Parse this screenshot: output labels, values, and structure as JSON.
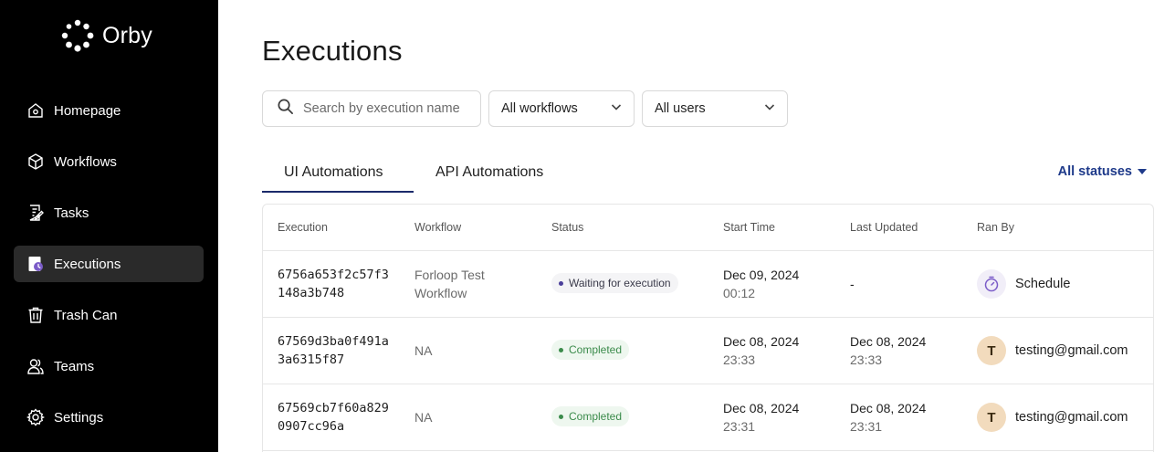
{
  "app": {
    "logo_text": "Orby"
  },
  "sidebar": {
    "items": [
      {
        "label": "Homepage",
        "icon": "home-icon"
      },
      {
        "label": "Workflows",
        "icon": "cube-icon"
      },
      {
        "label": "Tasks",
        "icon": "tasks-icon"
      },
      {
        "label": "Executions",
        "icon": "executions-icon",
        "active": true
      },
      {
        "label": "Trash Can",
        "icon": "trash-icon"
      },
      {
        "label": "Teams",
        "icon": "teams-icon"
      },
      {
        "label": "Settings",
        "icon": "gear-icon"
      }
    ]
  },
  "main": {
    "title": "Executions",
    "search_placeholder": "Search by execution name",
    "workflow_filter": "All workflows",
    "user_filter": "All users",
    "tabs": [
      {
        "label": "UI Automations",
        "active": true
      },
      {
        "label": "API Automations",
        "active": false
      }
    ],
    "status_filter": "All statuses"
  },
  "table": {
    "columns": [
      "Execution",
      "Workflow",
      "Status",
      "Start Time",
      "Last Updated",
      "Ran By"
    ],
    "rows": [
      {
        "execution": "6756a653f2c57f3148a3b748",
        "workflow": "Forloop Test Workflow",
        "status": "Waiting for execution",
        "start_date": "Dec 09, 2024",
        "start_time": "00:12",
        "updated": "-",
        "ran_by": "Schedule"
      },
      {
        "execution": "67569d3ba0f491a3a6315f87",
        "workflow": "NA",
        "status": "Completed",
        "start_date": "Dec 08, 2024",
        "start_time": "23:33",
        "updated_date": "Dec 08, 2024",
        "updated_time": "23:33",
        "avatar": "T",
        "ran_by": "testing@gmail.com"
      },
      {
        "execution": "67569cb7f60a8290907cc96a",
        "workflow": "NA",
        "status": "Completed",
        "start_date": "Dec 08, 2024",
        "start_time": "23:31",
        "updated_date": "Dec 08, 2024",
        "updated_time": "23:31",
        "avatar": "T",
        "ran_by": "testing@gmail.com"
      }
    ]
  },
  "colors": {
    "sidebar_bg": "#000000",
    "accent": "#1b2a6b",
    "completed": "#3b8b4b"
  }
}
